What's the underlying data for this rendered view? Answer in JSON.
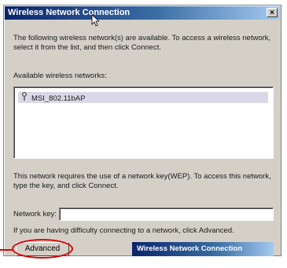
{
  "window": {
    "title": "Wireless Network Connection",
    "close_glyph": "×"
  },
  "intro_text": "The following wireless network(s) are available. To access a wireless network, select it from the list, and then click Connect.",
  "available_label": "Available wireless networks:",
  "networks": [
    {
      "name": "MSI_802.11bAP",
      "icon": "antenna-icon"
    }
  ],
  "wep_text": "This network requires the use of a network key(WEP). To access this network, type the key, and click Connect.",
  "key_field": {
    "label": "Network key:",
    "value": ""
  },
  "trouble_text": "If you are having difficulty connecting to a network, click Advanced.",
  "advanced_button": "Advanced",
  "taskbar_item": "Wireless Network Connection",
  "colors": {
    "highlight": "#e00000",
    "title_gradient_start": "#0a246a",
    "dialog_face": "#d4d0c8"
  }
}
